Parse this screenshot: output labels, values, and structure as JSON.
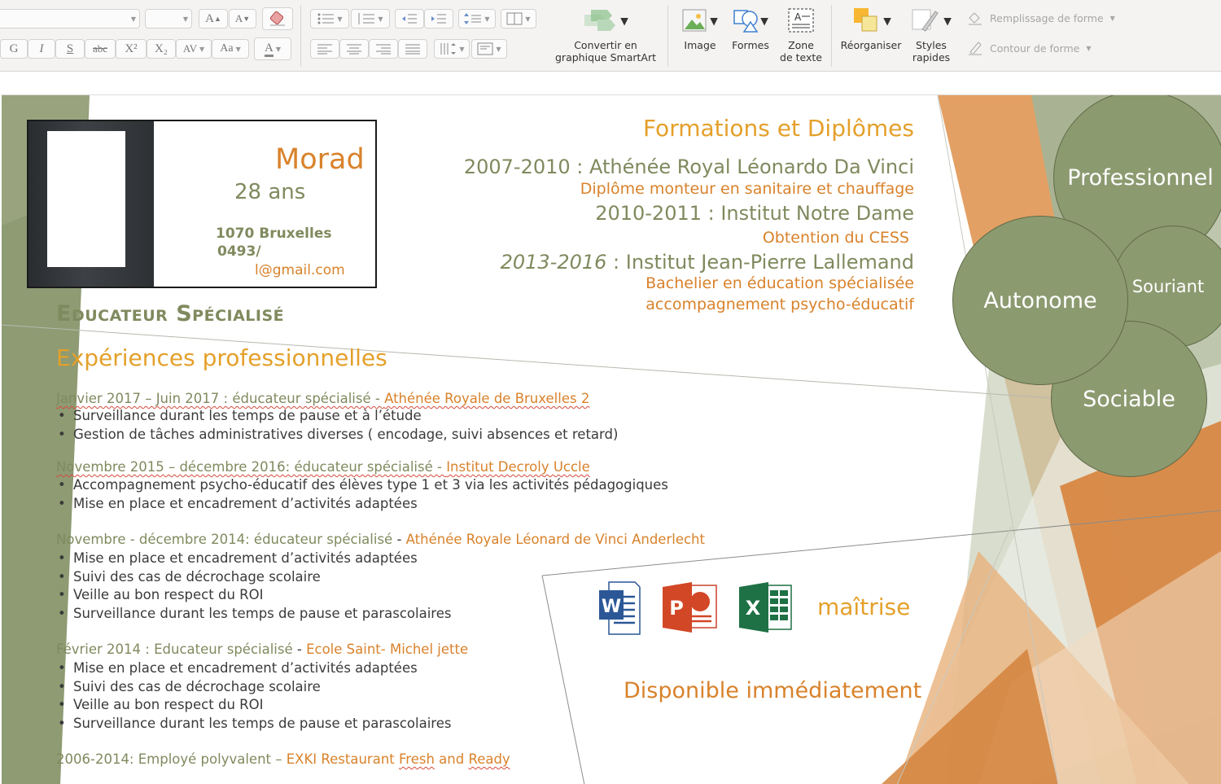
{
  "ribbon": {
    "font_buttons": [
      "G",
      "I",
      "S",
      "abc",
      "X²",
      "X₂",
      "AV",
      "Aa",
      "A"
    ],
    "grow_label": "A",
    "shrink_label": "A",
    "convert_smartart_line1": "Convertir en",
    "convert_smartart_line2": "graphique SmartArt",
    "image_label": "Image",
    "shapes_label": "Formes",
    "textbox_line1": "Zone",
    "textbox_line2": "de texte",
    "arrange_label": "Réorganiser",
    "quickstyles_line1": "Styles",
    "quickstyles_line2": "rapides",
    "shape_fill_label": "Remplissage de forme",
    "shape_outline_label": "Contour de forme"
  },
  "profile": {
    "name": "Morad",
    "age": "28 ans",
    "city": "1070 Bruxelles",
    "phone": "0493/",
    "email": "l@gmail.com",
    "job_title": "Educateur Spécialisé"
  },
  "formations": {
    "heading": "Formations et Diplômes",
    "entries": [
      {
        "line": "2007-2010 : Athénée Royal Léonardo Da Vinci",
        "detail": "Diplôme monteur en sanitaire et chauffage"
      },
      {
        "line": "2010-2011 : Institut  Notre Dame",
        "detail": "Obtention du CESS"
      },
      {
        "line_years": "2013-2016",
        "line_rest": " : Institut Jean-Pierre Lallemand",
        "detail": "Bachelier en éducation spécialisée",
        "detail2": "accompagnement psycho-éducatif"
      }
    ]
  },
  "experiences": {
    "heading": "Expériences professionnelles",
    "items": [
      {
        "title": "Janvier 2017 – Juin 2017 : éducateur spécialisé  - ",
        "place": "Athénée Royale de Bruxelles 2",
        "bullets": [
          "Surveillance durant les temps de pause et à l’étude",
          "Gestion de tâches administratives diverses ( encodage, suivi absences et retard)"
        ]
      },
      {
        "title": "Novembre 2015 – décembre  2016: éducateur spécialisé  - ",
        "place": "Institut Decroly Uccle",
        "bullets": [
          "Accompagnement psycho-éducatif des élèves  type 1 et  3 via les activités pédagogiques",
          "Mise en place et encadrement d’activités adaptées"
        ]
      },
      {
        "title": "Novembre - décembre 2014: éducateur spécialisé ",
        "sep": "- ",
        "place": "Athénée Royale Léonard de Vinci Anderlecht",
        "bullets": [
          "Mise en place et encadrement d’activités adaptées",
          "Suivi des cas de décrochage scolaire",
          "Veille au bon respect du ROI",
          "Surveillance durant les temps de pause et parascolaires"
        ]
      },
      {
        "title": "Février 2014 : Educateur spécialisé ",
        "sep": "- ",
        "place": "Ecole Saint- Michel jette",
        "bullets": [
          "Mise en place et encadrement d’activités adaptées",
          "Suivi des cas de décrochage scolaire",
          "Veille au bon respect du ROI",
          "Surveillance durant les temps de pause et parascolaires"
        ]
      },
      {
        "title": "2006-2014: Employé polyvalent – ",
        "place_a": "EXKI Restaurant ",
        "place_b": "Fresh",
        "place_c": " and ",
        "place_d": "Ready",
        "bullets": []
      }
    ]
  },
  "qualities": [
    "Professionnel",
    "Autonome",
    "Souriant",
    "Sociable"
  ],
  "skills": {
    "apps": [
      "Word",
      "PowerPoint",
      "Excel"
    ],
    "app_letters": [
      "W",
      "P",
      "X"
    ],
    "label": "maîtrise"
  },
  "availability": "Disponible immédiatement",
  "colors": {
    "olive": "#7f8a5e",
    "orange": "#d9822b",
    "circle_fill": "#8c9a70",
    "ribbon_bg": "#f4f3f2"
  }
}
